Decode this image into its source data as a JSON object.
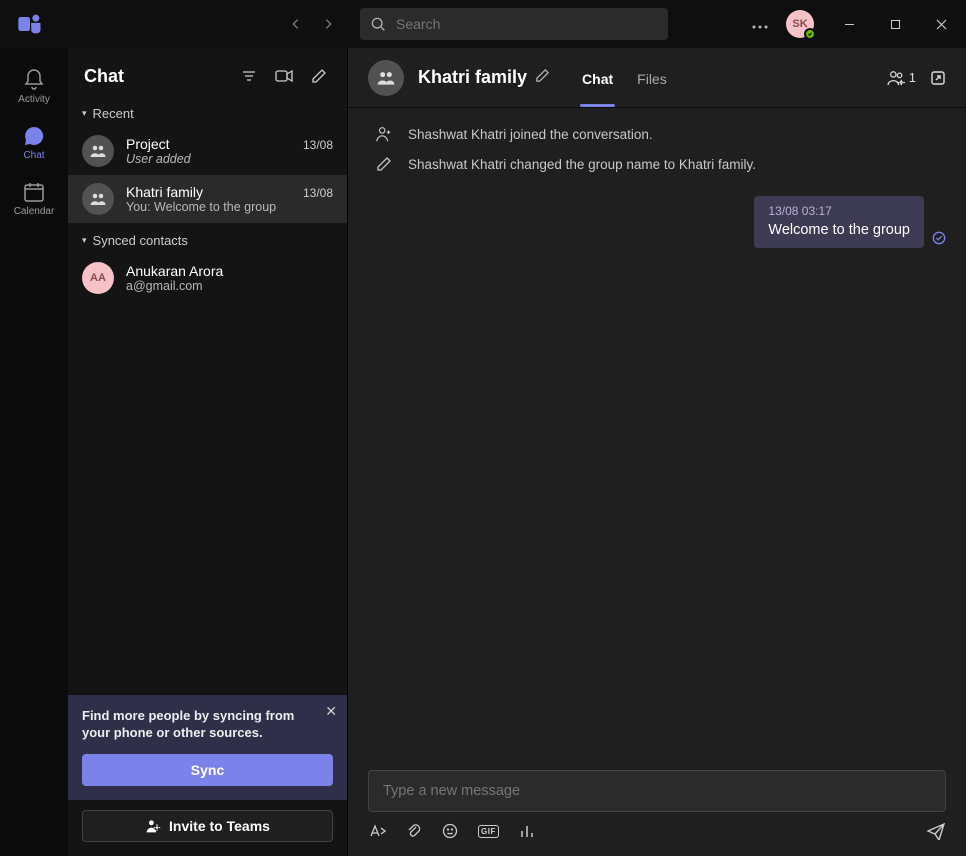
{
  "titlebar": {
    "search_placeholder": "Search",
    "avatar_initials": "SK"
  },
  "rail": {
    "activity": "Activity",
    "chat": "Chat",
    "calendar": "Calendar"
  },
  "sidebar": {
    "title": "Chat",
    "sections": {
      "recent": "Recent",
      "synced": "Synced contacts"
    },
    "items": [
      {
        "name": "Project",
        "preview": "User added",
        "date": "13/08",
        "italic": true
      },
      {
        "name": "Khatri family",
        "preview": "You: Welcome to the group",
        "date": "13/08",
        "italic": false
      }
    ],
    "contacts": [
      {
        "name": "Anukaran Arora",
        "initials": "AA",
        "email": "a@gmail.com"
      }
    ],
    "sync_prompt": "Find more people by syncing from your phone or other sources.",
    "sync_button": "Sync",
    "invite_button": "Invite to Teams"
  },
  "content": {
    "group_name": "Khatri family",
    "tabs": {
      "chat": "Chat",
      "files": "Files"
    },
    "participants_count": "1",
    "system_messages": [
      "Shashwat Khatri joined the conversation.",
      "Shashwat Khatri changed the group name to Khatri family."
    ],
    "message": {
      "timestamp": "13/08 03:17",
      "text": "Welcome to the group"
    },
    "composer_placeholder": "Type a new message",
    "gif_label": "GIF"
  }
}
